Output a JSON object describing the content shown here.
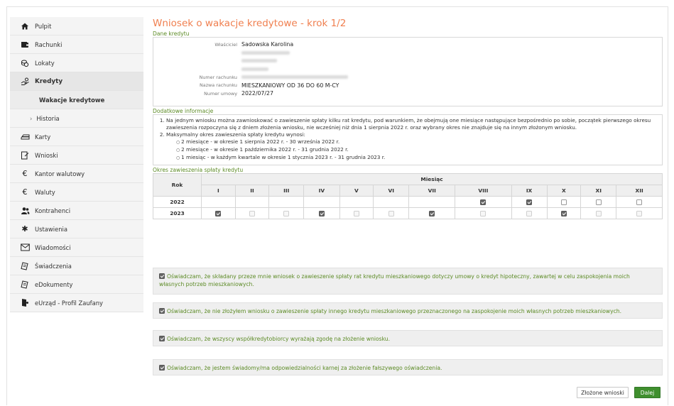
{
  "sidebar": {
    "items": [
      {
        "label": "Pulpit",
        "icon": "home-icon"
      },
      {
        "label": "Rachunki",
        "icon": "wallet-icon"
      },
      {
        "label": "Lokaty",
        "icon": "coins-icon"
      },
      {
        "label": "Kredyty",
        "icon": "hand-money-icon"
      },
      {
        "label": "Wakacje kredytowe",
        "icon": ""
      },
      {
        "label": "Historia",
        "icon": "chevron-right-icon"
      },
      {
        "label": "Karty",
        "icon": "card-icon"
      },
      {
        "label": "Wnioski",
        "icon": "form-icon"
      },
      {
        "label": "Kantor walutowy",
        "icon": "euro-icon"
      },
      {
        "label": "Waluty",
        "icon": "euro-icon"
      },
      {
        "label": "Kontrahenci",
        "icon": "users-icon"
      },
      {
        "label": "Ustawienia",
        "icon": "gear-icon"
      },
      {
        "label": "Wiadomości",
        "icon": "mail-icon"
      },
      {
        "label": "Świadczenia",
        "icon": "document-icon"
      },
      {
        "label": "eDokumenty",
        "icon": "document-icon"
      },
      {
        "label": "eUrząd - Profil Zaufany",
        "icon": "id-icon"
      }
    ]
  },
  "page": {
    "title": "Wniosek o wakacje kredytowe - krok 1/2",
    "loan_section": "Dane kredytu",
    "owner_label": "Właściciel",
    "owner_value": "Sadowska Karolina",
    "account_number_label": "Numer rachunku",
    "account_name_label": "Nazwa rachunku",
    "account_name_value": "MIESZKANIOWY OD 36 DO 60 M-CY",
    "contract_number_label": "Numer umowy",
    "contract_number_value": "2022/07/27",
    "info_section": "Dodatkowe informacje",
    "info_1": "Na jednym wniosku można zawnioskować o zawieszenie spłaty kilku rat kredytu, pod warunkiem, że obejmują one miesiące następujące bezpośrednio po sobie, początek pierwszego okresu zawieszenia rozpoczyna się z dniem złożenia wniosku, nie wcześniej niż dnia 1 sierpnia 2022 r. oraz wybrany okres nie znajduje się na innym złożonym wniosku.",
    "info_2": "Maksymalny okres zawieszenia spłaty kredytu wynosi:",
    "info_2a": "2 miesiące - w okresie 1 sierpnia 2022 r. - 30 września 2022 r.",
    "info_2b": "2 miesiące - w okresie 1 października 2022 r. - 31 grudnia 2022 r.",
    "info_2c": "1 miesiąc - w każdym kwartale w okresie 1 stycznia 2023 r. - 31 grudnia 2023 r.",
    "period_section": "Okres zawieszenia spłaty kredytu"
  },
  "table": {
    "year_header": "Rok",
    "month_header": "Miesiąc",
    "months": [
      "I",
      "II",
      "III",
      "IV",
      "V",
      "VI",
      "VII",
      "VIII",
      "IX",
      "X",
      "XI",
      "XII"
    ],
    "rows": [
      {
        "year": "2022",
        "cells": [
          "none",
          "none",
          "none",
          "none",
          "none",
          "none",
          "none",
          "checked",
          "checked",
          "empty",
          "empty",
          "empty"
        ]
      },
      {
        "year": "2023",
        "cells": [
          "checked",
          "disabled",
          "disabled",
          "checked",
          "disabled",
          "disabled",
          "checked",
          "disabled",
          "disabled",
          "checked",
          "disabled",
          "disabled"
        ]
      }
    ]
  },
  "declarations": [
    "Oświadczam, że składany przeze mnie wniosek o zawieszenie spłaty rat kredytu mieszkaniowego dotyczy umowy o kredyt hipoteczny, zawartej w celu zaspokojenia moich własnych potrzeb mieszkaniowych.",
    "Oświadczam, że nie złożyłem wniosku o zawieszenie spłaty innego kredytu mieszkaniowego przeznaczonego na zaspokojenie moich własnych potrzeb mieszkaniowych.",
    "Oświadczam, że wszyscy współkredytobiorcy wyrażają zgodę na złożenie wniosku.",
    "Oświadczam, że jestem świadomy/ma odpowiedzialności karnej za złożenie fałszywego oświadczenia."
  ],
  "buttons": {
    "submitted": "Złożone wnioski",
    "next": "Dalej"
  },
  "colors": {
    "accent_title": "#f07f4f",
    "accent_green": "#5b8a24",
    "primary_button": "#3f8f2e"
  }
}
